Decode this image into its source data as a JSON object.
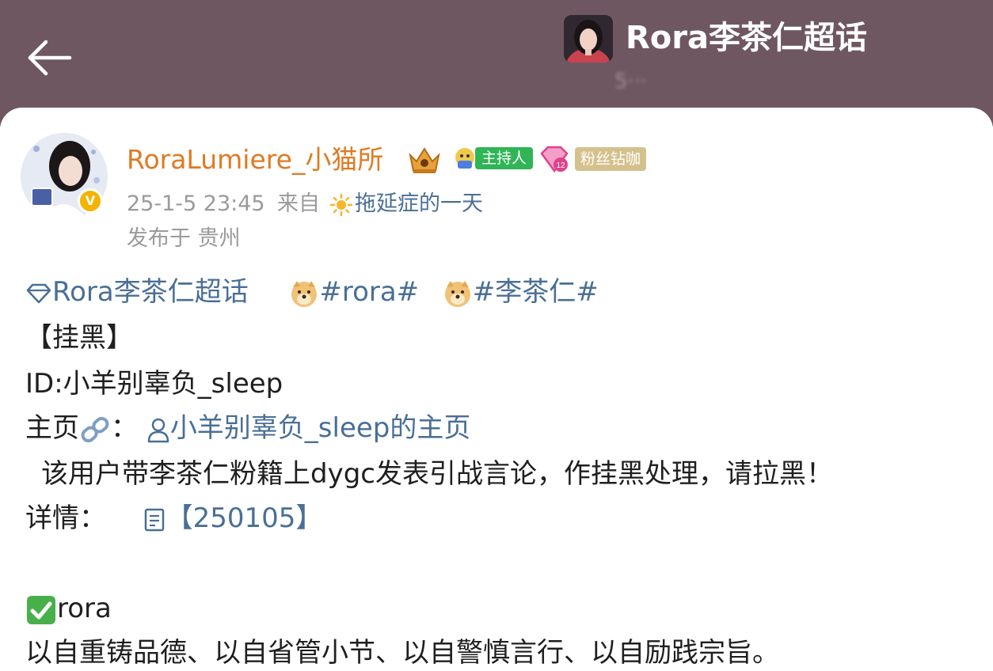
{
  "header": {
    "topic_title": "Rora李茶仁超话",
    "topic_subtitle": "5···"
  },
  "post": {
    "username": "RoraLumiere_小猫所",
    "host_badge": "主持人",
    "fan_badge_level": "12",
    "fan_badge": "粉丝钻咖",
    "time": "25-1-5 23:45",
    "from_label": "来自",
    "source": "拖延症的一天",
    "location": "发布于 贵州",
    "body": {
      "topic_link": "Rora李茶仁超话",
      "hashtag_1": "#rora#",
      "hashtag_2": "#李茶仁#",
      "title": "【挂黑】",
      "id_line": "ID:小羊别辜负_sleep",
      "homepage_label": "主页",
      "homepage_colon": "：",
      "homepage_link": "小羊别辜负_sleep的主页",
      "statement": "该用户带李茶仁粉籍上dygc发表引战言论，作挂黑处理，请拉黑！",
      "details_label": "详情：",
      "details_link": "【250105】",
      "rora_line": "rora",
      "motto": "以自重铸品德、以自省管小节、以自警慎言行、以自励践宗旨。"
    }
  },
  "icons": {
    "back": "back-arrow-icon",
    "diamond": "diamond-icon",
    "doge": "doge-emoji-icon",
    "link": "link-emoji-icon",
    "person": "person-icon",
    "document": "document-icon",
    "check": "check-mark-emoji-icon",
    "sun": "sun-icon",
    "crown": "crown-badge-icon",
    "verified": "verified-badge-icon"
  },
  "colors": {
    "header_bg": "#6f5761",
    "username": "#e07a22",
    "link": "#4a6f96",
    "meta": "#9a9a9a",
    "host_badge": "#2fb556",
    "fan_badge": "#d5c18d"
  }
}
